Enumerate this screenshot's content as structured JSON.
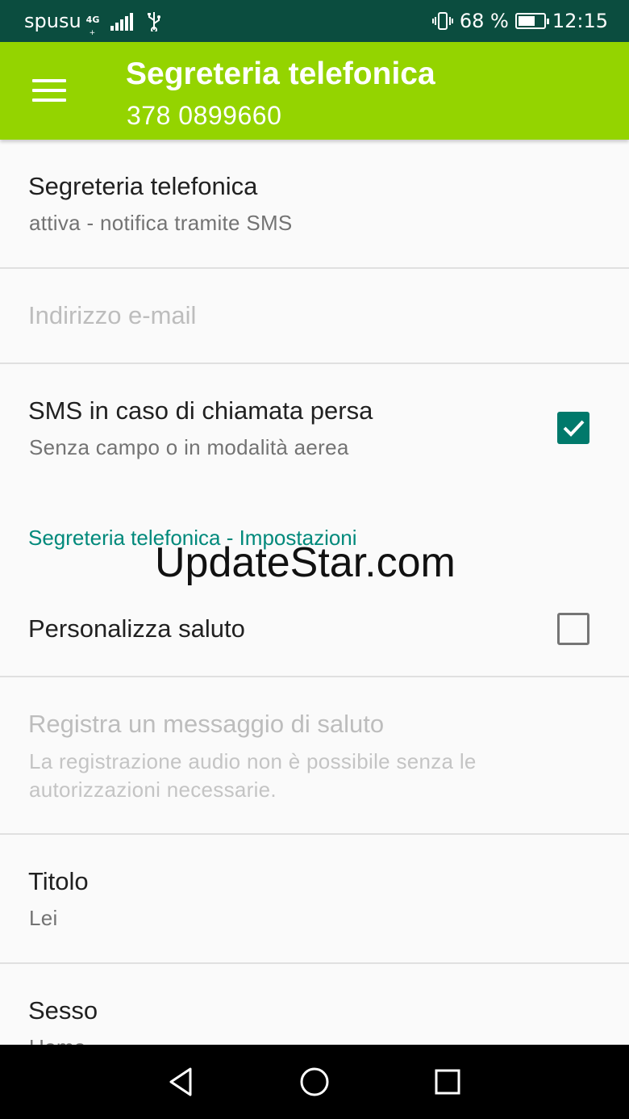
{
  "status_bar": {
    "carrier": "spusu",
    "network_type": "4G",
    "network_sub": "+",
    "battery_percent": "68 %",
    "battery_level": 0.68,
    "time": "12:15"
  },
  "app_bar": {
    "title": "Segreteria telefonica",
    "subtitle": "378 0899660",
    "color": "#94d400"
  },
  "preferences": [
    {
      "title": "Segreteria telefonica",
      "summary": "attiva - notifica tramite SMS"
    },
    {
      "title": "Indirizzo e-mail",
      "enabled": false
    },
    {
      "title": "SMS in caso di chiamata persa",
      "summary": "Senza campo o in modalità aerea",
      "checked": true
    }
  ],
  "section": {
    "header": "Segreteria telefonica - Impostazioni"
  },
  "settings": [
    {
      "title": "Personalizza saluto",
      "checked": false
    },
    {
      "title": "Registra un messaggio di saluto",
      "summary_line1": "La registrazione audio non è possibile senza le",
      "summary_line2": "autorizzazioni necessarie.",
      "enabled": false
    },
    {
      "title": "Titolo",
      "summary": "Lei"
    },
    {
      "title": "Sesso",
      "summary": "Uomo"
    }
  ],
  "watermark": "UpdateStar.com",
  "colors": {
    "status_bar": "#0b4d3f",
    "accent": "#00897b",
    "checkbox_checked": "#00796b"
  },
  "icons": {
    "menu": "hamburger-menu-icon",
    "back": "back-triangle-icon",
    "home": "home-circle-icon",
    "recents": "recents-square-icon"
  }
}
